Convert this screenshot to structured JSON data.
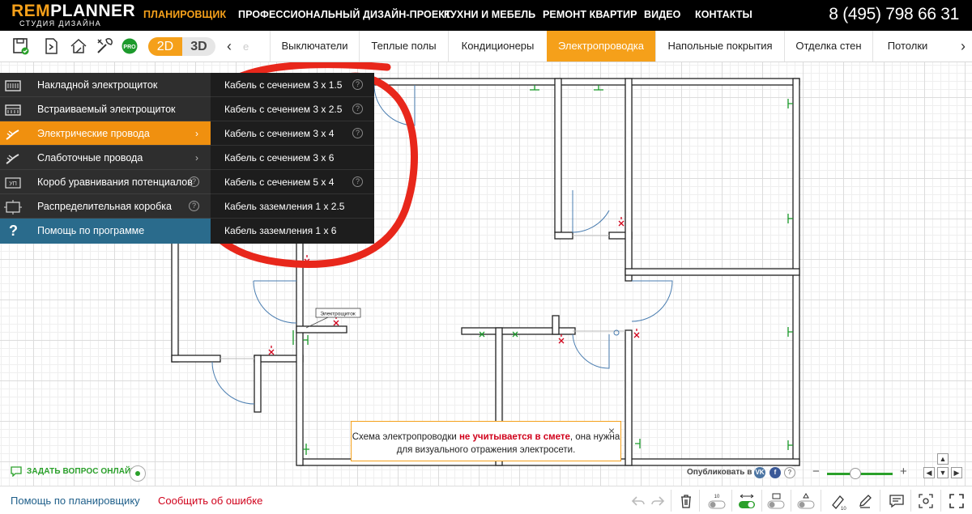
{
  "header": {
    "logo_top_a": "REM",
    "logo_top_b": "PLANNER",
    "logo_sub": "СТУДИЯ ДИЗАЙНА",
    "nav": [
      "ПЛАНИРОВЩИК",
      "ПРОФЕССИОНАЛЬНЫЙ ДИЗАЙН-ПРОЕКТ",
      "КУХНИ И МЕБЕЛЬ",
      "РЕМОНТ КВАРТИР",
      "ВИДЕО",
      "КОНТАКТЫ"
    ],
    "nav_active": "ПЛАНИРОВЩИК",
    "phone": "8 (495) 798 66 31"
  },
  "toolbar": {
    "pro_badge": "PRO",
    "mode_2d": "2D",
    "mode_3d": "3D",
    "mode_selected": "2D",
    "tab_prev_icon": "chevron-left",
    "tab_cut_text": "е",
    "tabs": [
      "Выключатели",
      "Теплые полы",
      "Кондиционеры",
      "Электропроводка",
      "Напольные покрытия",
      "Отделка стен",
      "Потолки"
    ],
    "active_tab": "Электропроводка",
    "tab_next_icon": "chevron-right"
  },
  "left_menu": {
    "items": [
      {
        "label": "Накладной электрощиток",
        "icon": "surface-panel-icon"
      },
      {
        "label": "Встраиваемый электрощиток",
        "icon": "flush-panel-icon"
      },
      {
        "label": "Электрические провода",
        "icon": "wire-icon",
        "has_submenu": true
      },
      {
        "label": "Слаботочные провода",
        "icon": "low-voltage-wire-icon",
        "has_submenu": true
      },
      {
        "label": "Короб уравнивания потенциалов",
        "icon": "equipotential-box-icon",
        "help": true
      },
      {
        "label": "Распределительная коробка",
        "icon": "junction-box-icon",
        "help": true
      },
      {
        "label": "Помощь по программе",
        "icon": "question-icon"
      }
    ],
    "active_item": "Электрические провода",
    "help_glyph": "?"
  },
  "submenu": {
    "items": [
      {
        "label": "Кабель с сечением 3 х 1.5",
        "help": true
      },
      {
        "label": "Кабель с сечением 3 х 2.5",
        "help": true
      },
      {
        "label": "Кабель с сечением 3 х 4",
        "help": true
      },
      {
        "label": "Кабель с сечением 3 х 6",
        "help": false
      },
      {
        "label": "Кабель с сечением 5 х 4",
        "help": true
      },
      {
        "label": "Кабель заземления 1 х 2.5",
        "help": false
      },
      {
        "label": "Кабель заземления 1 х 6",
        "help": false
      }
    ]
  },
  "plan": {
    "panel_label": "Электрощиток"
  },
  "notice": {
    "text_before": "Схема электропроводки ",
    "text_em": "не учитывается в смете",
    "text_after": ", она нужна для визуального отражения электросети.",
    "close": "×"
  },
  "canvas_widgets": {
    "ask_online": "ЗАДАТЬ ВОПРОС ОНЛАЙН",
    "publish_label": "Опубликовать в",
    "social": [
      "VK",
      "f",
      "?"
    ],
    "zoom_minus": "−",
    "zoom_plus": "+",
    "zoom_level": 0.43
  },
  "footer": {
    "help_planner": "Помощь по планировщику",
    "report_error": "Сообщить об ошибке",
    "height_badge": "10",
    "mark_badge": "10"
  },
  "colors": {
    "accent": "#f5a01a",
    "menu_bg": "#2e2e2e",
    "submenu_bg": "#1d1d1d",
    "help_item_bg": "#2a6b8c",
    "annotation_red": "#e8271b",
    "green": "#2aa02a"
  }
}
